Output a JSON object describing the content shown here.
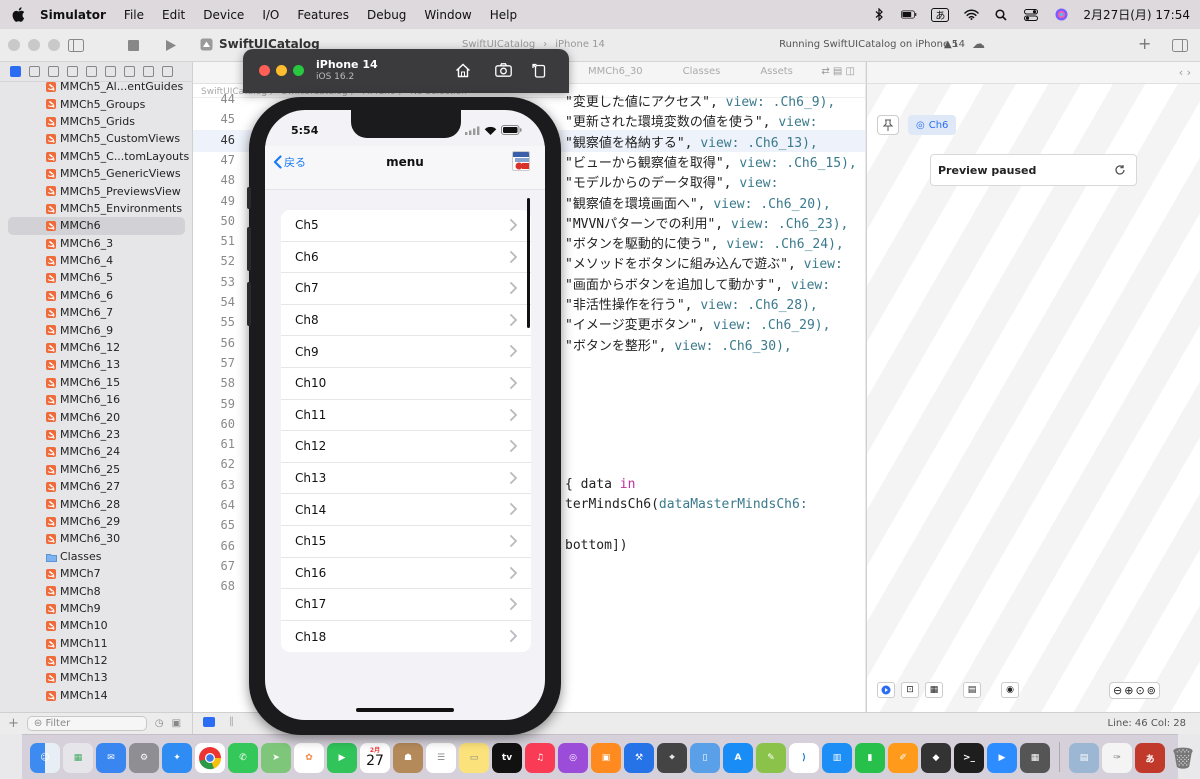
{
  "menubar": {
    "app": "Simulator",
    "items": [
      "File",
      "Edit",
      "Device",
      "I/O",
      "Features",
      "Debug",
      "Window",
      "Help"
    ],
    "input_indicator": "あ",
    "clock": "2月27日(月)  17:54"
  },
  "xcode": {
    "scheme": "SwiftUICatalog",
    "destination_scheme": "SwiftUICatalog",
    "destination_device": "iPhone 14",
    "status": "Running SwiftUICatalog on iPhone 14",
    "warnings": "5",
    "jump_tabs": [
      "MMCh6_30",
      "Classes",
      "Assets"
    ],
    "breadcrumb": "SwiftUICatalog 〉 SwiftUICatalog 〉 MMCh6 〉 No Selection"
  },
  "navigator": {
    "items": [
      "MMCh5_Al...entGuides",
      "MMCh5_Groups",
      "MMCh5_Grids",
      "MMCh5_CustomViews",
      "MMCh5_C...tomLayouts",
      "MMCh5_GenericViews",
      "MMCh5_PreviewsView",
      "MMCh5_Environments",
      "MMCh6",
      "MMCh6_3",
      "MMCh6_4",
      "MMCh6_5",
      "MMCh6_6",
      "MMCh6_7",
      "MMCh6_9",
      "MMCh6_12",
      "MMCh6_13",
      "MMCh6_15",
      "MMCh6_16",
      "MMCh6_20",
      "MMCh6_23",
      "MMCh6_24",
      "MMCh6_25",
      "MMCh6_27",
      "MMCh6_28",
      "MMCh6_29",
      "MMCh6_30",
      "Classes",
      "MMCh7",
      "MMCh8",
      "MMCh9",
      "MMCh10",
      "MMCh11",
      "MMCh12",
      "MMCh13",
      "MMCh14"
    ],
    "selected": "MMCh6",
    "filter_placeholder": "Filter"
  },
  "editor": {
    "lines": [
      {
        "n": "44",
        "pre": "\"変更した値にアクセス\", ",
        "view": "view",
        "post": ": .Ch6_9),"
      },
      {
        "n": "45",
        "pre": "\"更新された環境変数の値を使う\", ",
        "view": "view",
        "post": ":"
      },
      {
        "n": "46",
        "pre": "\"観察値を格納する\", ",
        "view": "view",
        "post": ": .Ch6_13),"
      },
      {
        "n": "47",
        "pre": "\"ビューから観察値を取得\", ",
        "view": "view",
        "post": ": .Ch6_15),"
      },
      {
        "n": "48",
        "pre": "\"モデルからのデータ取得\", ",
        "view": "view",
        "post": ":"
      },
      {
        "n": "49",
        "pre": "\"観察値を環境画面へ\", ",
        "view": "view",
        "post": ": .Ch6_20),"
      },
      {
        "n": "50",
        "pre": "\"MVVNパターンでの利用\", ",
        "view": "view",
        "post": ": .Ch6_23),"
      },
      {
        "n": "51",
        "pre": "\"ボタンを駆動的に使う\", ",
        "view": "view",
        "post": ": .Ch6_24),"
      },
      {
        "n": "52",
        "pre": "\"メソッドをボタンに組み込んで遊ぶ\", ",
        "view": "view",
        "post": ":"
      },
      {
        "n": "53",
        "pre": "\"画面からボタンを追加して動かす\", ",
        "view": "view",
        "post": ":"
      },
      {
        "n": "54",
        "pre": "\"非活性操作を行う\", ",
        "view": "view",
        "post": ": .Ch6_28),"
      },
      {
        "n": "55",
        "pre": "\"イメージ変更ボタン\", ",
        "view": "view",
        "post": ": .Ch6_29),"
      },
      {
        "n": "56",
        "pre": "\"ボタンを整形\", ",
        "view": "view",
        "post": ": .Ch6_30),"
      },
      {
        "n": "57",
        "pre": "",
        "view": "",
        "post": ""
      },
      {
        "n": "58",
        "pre": "",
        "view": "",
        "post": ""
      },
      {
        "n": "59",
        "pre": "",
        "view": "",
        "post": ""
      },
      {
        "n": "60",
        "pre": "",
        "view": "",
        "post": ""
      },
      {
        "n": "61",
        "pre": "",
        "view": "",
        "post": ""
      },
      {
        "n": "62",
        "pre": "",
        "view": "",
        "post": ""
      },
      {
        "n": "63",
        "pre": "{ data ",
        "view": "in",
        "post": ""
      },
      {
        "n": "64",
        "pre": "terMindsCh6(",
        "view": "dataMasterMindsCh6",
        "post": ":"
      },
      {
        "n": "65",
        "pre": "",
        "view": "",
        "post": ""
      },
      {
        "n": "66",
        "pre": "bottom])",
        "view": "",
        "post": ""
      },
      {
        "n": "67",
        "pre": "",
        "view": "",
        "post": ""
      },
      {
        "n": "68",
        "pre": "",
        "view": "",
        "post": ""
      }
    ],
    "highlighted_line": "46"
  },
  "preview": {
    "chip": "Ch6",
    "paused_label": "Preview paused"
  },
  "statusbar": {
    "line_col": "Line: 46  Col: 28"
  },
  "simulator": {
    "device_name": "iPhone 14",
    "os": "iOS 16.2"
  },
  "phone": {
    "time": "5:54",
    "back_label": "戻る",
    "title": "menu",
    "menu_items": [
      "Ch5",
      "Ch6",
      "Ch7",
      "Ch8",
      "Ch9",
      "Ch10",
      "Ch11",
      "Ch12",
      "Ch13",
      "Ch14",
      "Ch15",
      "Ch16",
      "Ch17",
      "Ch18"
    ]
  },
  "dock": {
    "calendar_month": "2月",
    "calendar_day": "27"
  },
  "colors": {
    "ios_blue": "#1a7cf5",
    "xcode_keyword": "#3a7a8c",
    "xcode_pink": "#c2329b",
    "swift_orange": "#ef6b3a"
  }
}
